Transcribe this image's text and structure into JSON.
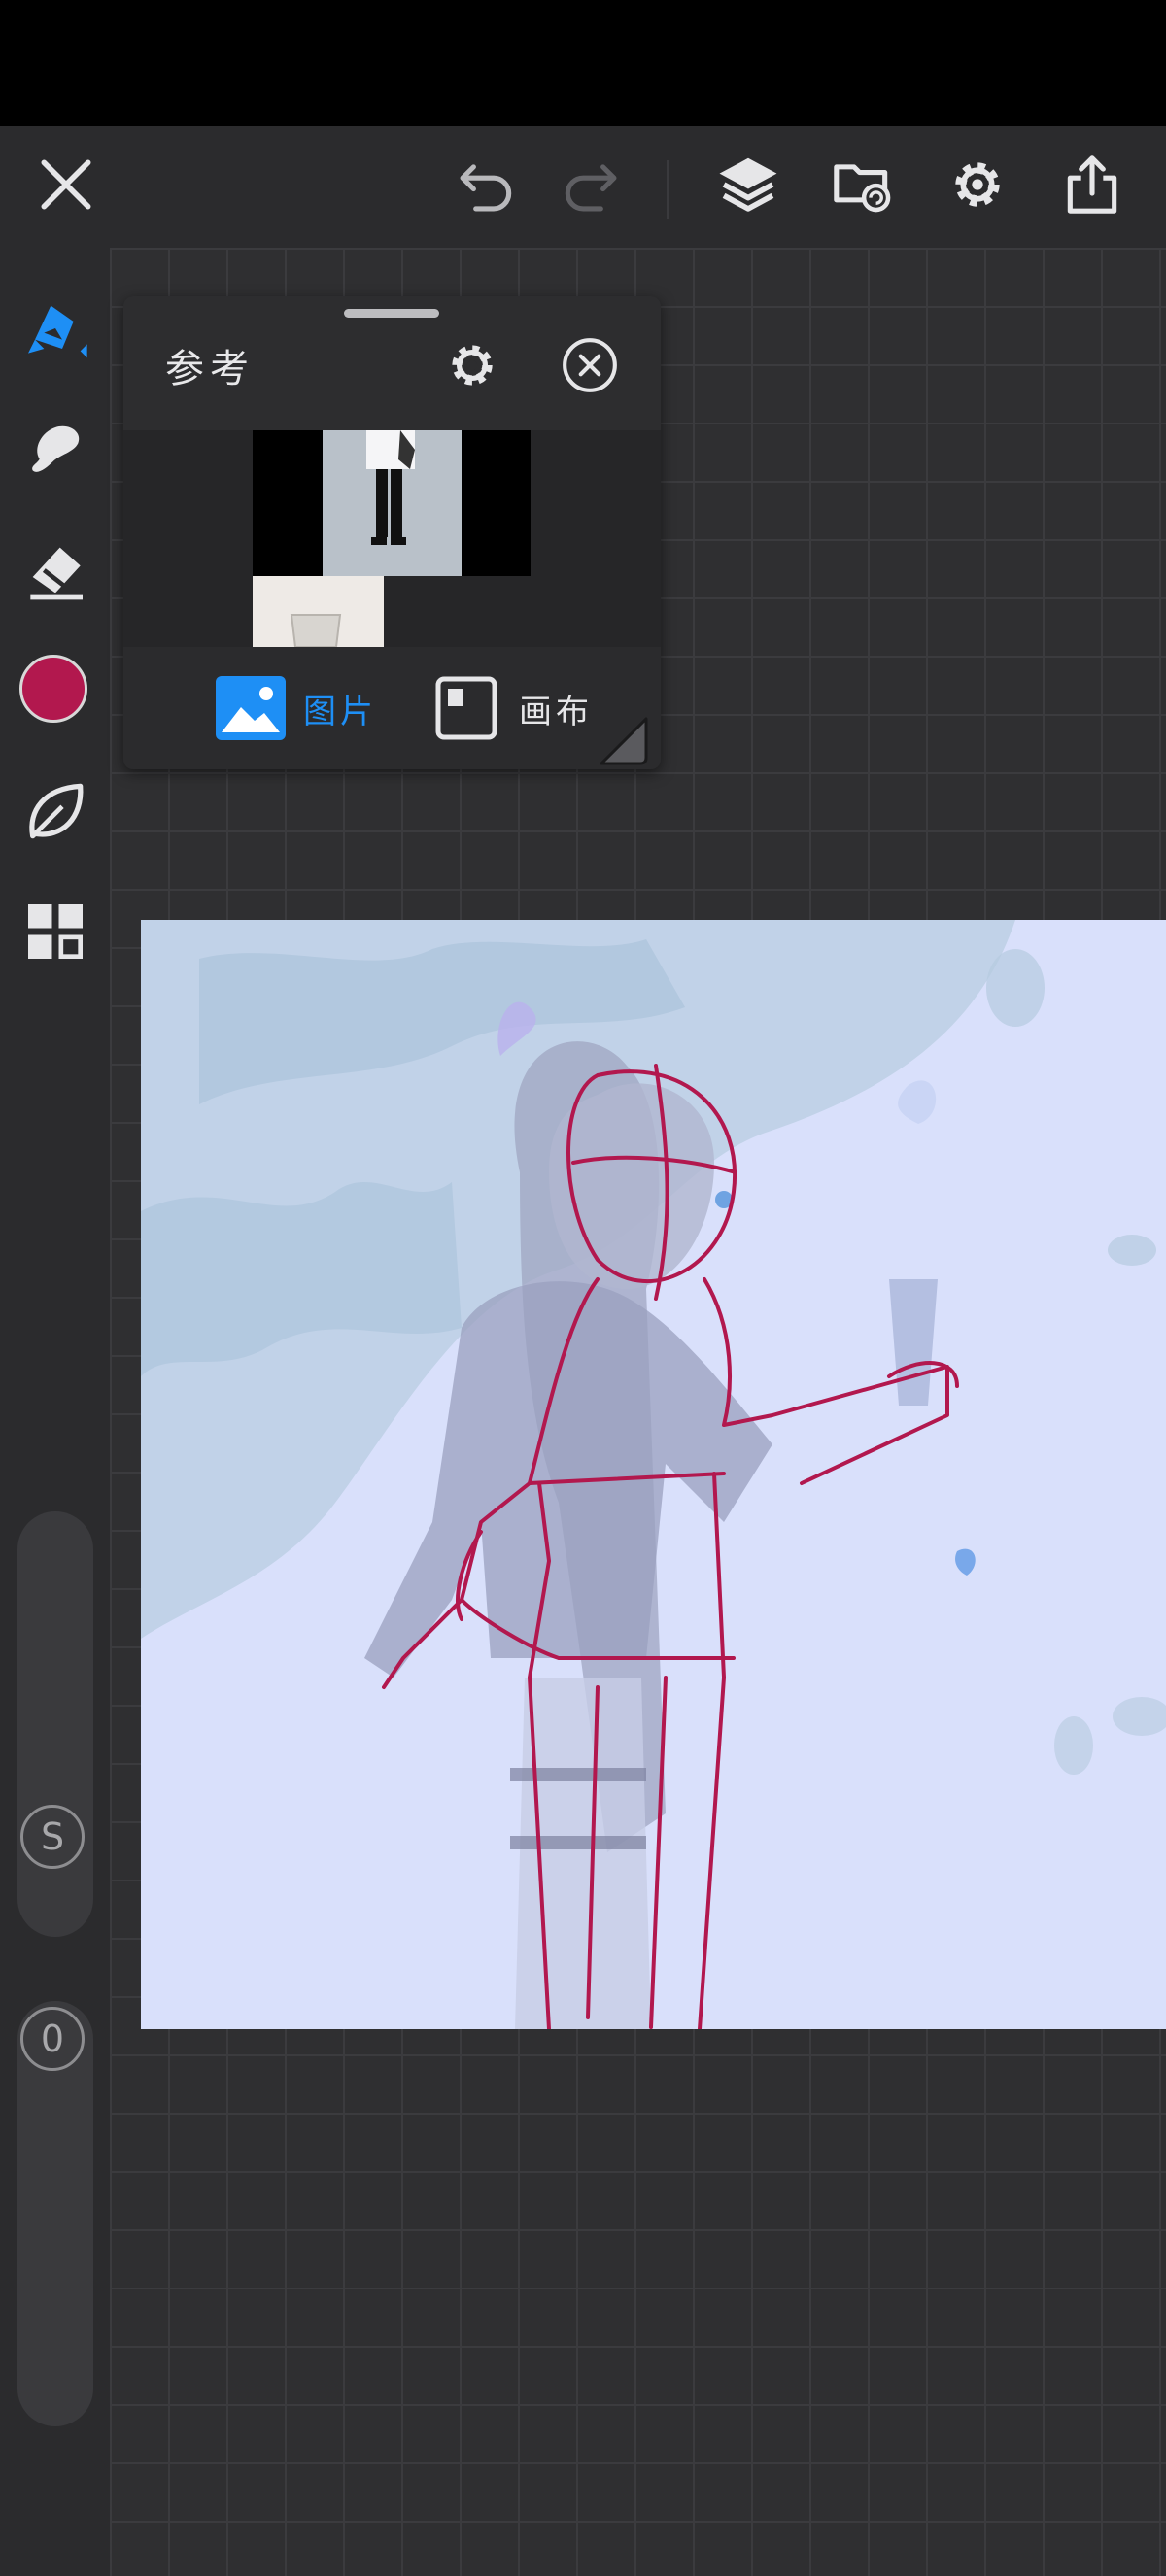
{
  "reference_panel": {
    "title": "参考",
    "modes": [
      {
        "label": "图片",
        "active": true
      },
      {
        "label": "画布",
        "active": false
      }
    ]
  },
  "left_toolbar": {
    "current_color": "#b2184e",
    "size_slider_label": "S",
    "opacity_slider_label": "0"
  },
  "colors": {
    "accent": "#1e8ff5",
    "toolbar_bg": "#2b2b2d",
    "sketch_line": "#b2184e"
  }
}
